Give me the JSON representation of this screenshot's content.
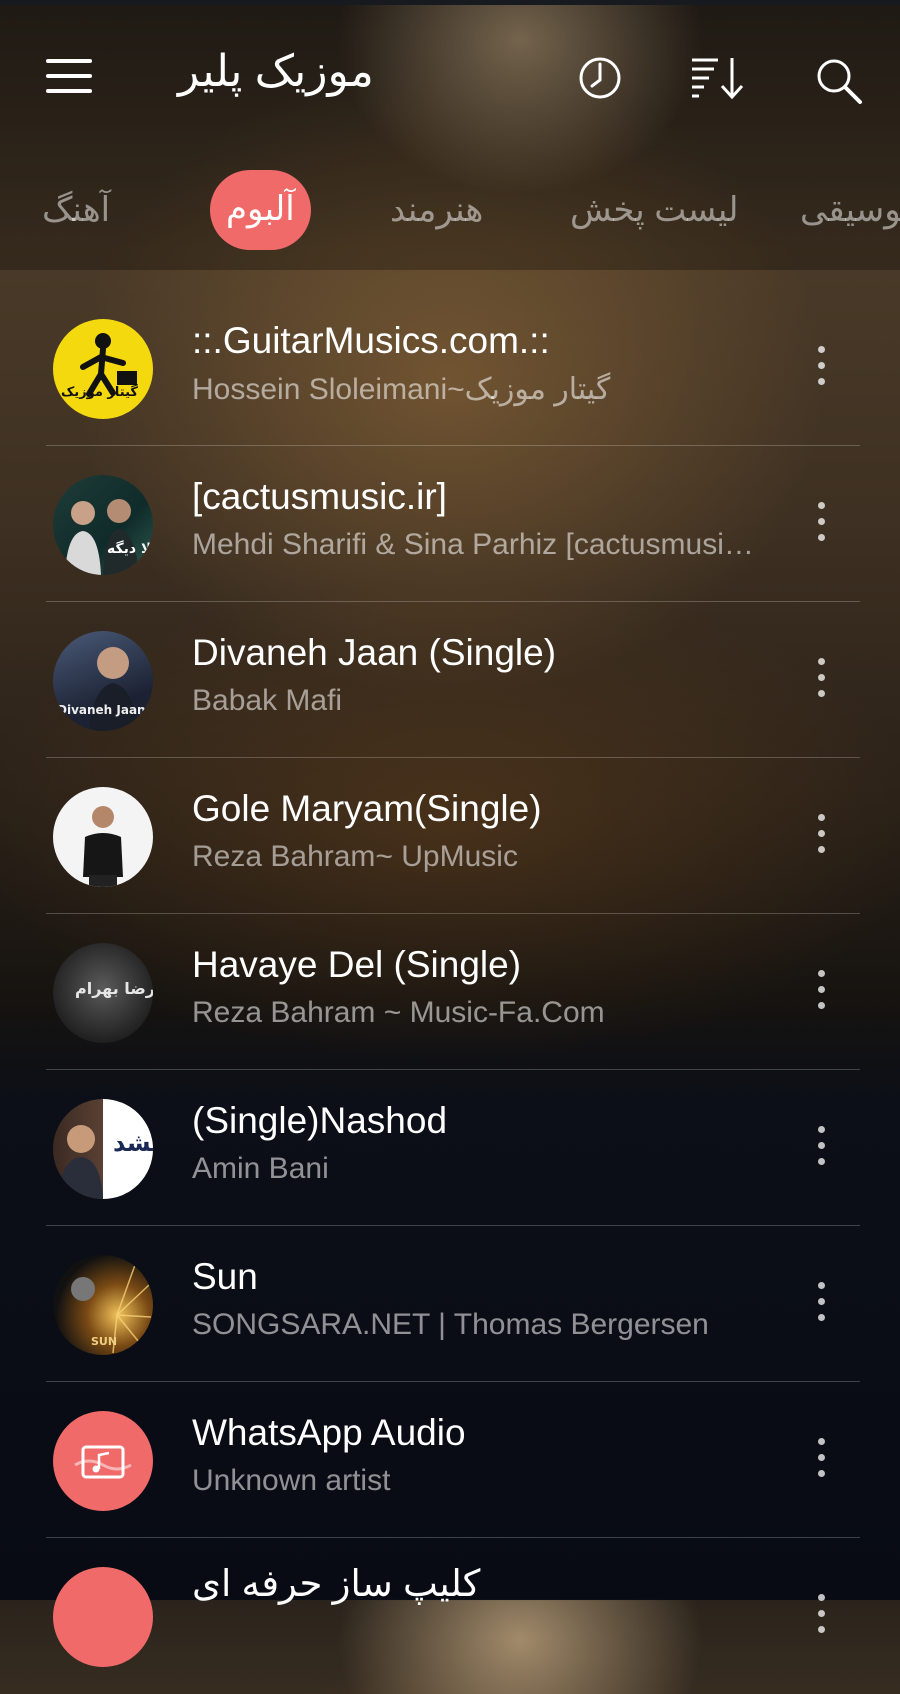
{
  "app": {
    "title": "موزیک پلیر"
  },
  "toolbar": {
    "menu_icon": "hamburger-menu-icon",
    "timer_icon": "clock-icon",
    "sort_icon": "sort-descending-icon",
    "search_icon": "search-icon"
  },
  "tabs": [
    {
      "label": "آهنگ",
      "active": false
    },
    {
      "label": "آلبوم",
      "active": true
    },
    {
      "label": "هنرمند",
      "active": false
    },
    {
      "label": "لیست پخش",
      "active": false
    },
    {
      "label": "موسیقی",
      "active": false
    }
  ],
  "colors": {
    "accent": "#f06a6a",
    "subtitle": "#a8a8a8",
    "divider": "#5a5a5a"
  },
  "albums": [
    {
      "title": "::.GuitarMusics.com.::",
      "artist": "Hossein Sloleimani~گیتار موزیک",
      "art_text": "گیتار موزیک"
    },
    {
      "title": "[cactusmusic.ir]",
      "artist": "Mehdi Sharifi & Sina Parhiz  [cactusmusic.ir]",
      "art_text": "حالا دیگه"
    },
    {
      "title": "Divaneh Jaan (Single)",
      "artist": "Babak Mafi",
      "art_text": "Divaneh Jaan"
    },
    {
      "title": "Gole Maryam(Single)",
      "artist": "Reza Bahram~ UpMusic",
      "art_text": ""
    },
    {
      "title": "Havaye Del (Single)",
      "artist": "Reza Bahram ~ Music-Fa.Com",
      "art_text": "رضا بهرام"
    },
    {
      "title": "(Single)Nashod",
      "artist": "Amin Bani",
      "art_text": "نشد"
    },
    {
      "title": "Sun",
      "artist": "SONGSARA.NET | Thomas Bergersen",
      "art_text": "SUN"
    },
    {
      "title": "WhatsApp Audio",
      "artist": "Unknown artist",
      "art_text": ""
    },
    {
      "title": "کلیپ ساز حرفه ای",
      "artist": "",
      "art_text": ""
    }
  ],
  "row_actions": {
    "more_icon": "more-vertical-icon"
  }
}
